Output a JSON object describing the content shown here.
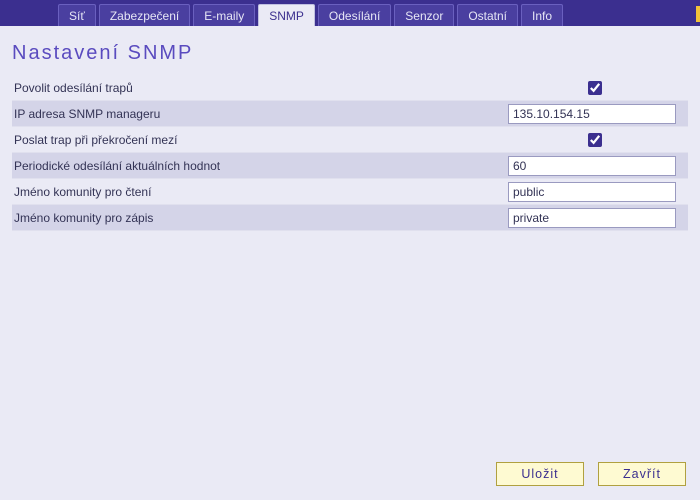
{
  "tabs": [
    {
      "id": "sit",
      "label": "Síť",
      "active": false
    },
    {
      "id": "zabezpeceni",
      "label": "Zabezpečení",
      "active": false
    },
    {
      "id": "emaily",
      "label": "E-maily",
      "active": false
    },
    {
      "id": "snmp",
      "label": "SNMP",
      "active": true
    },
    {
      "id": "odesilani",
      "label": "Odesílání",
      "active": false
    },
    {
      "id": "senzor",
      "label": "Senzor",
      "active": false
    },
    {
      "id": "ostatni",
      "label": "Ostatní",
      "active": false
    },
    {
      "id": "info",
      "label": "Info",
      "active": false
    }
  ],
  "page_title": "Nastavení SNMP",
  "rows": {
    "enable_traps": {
      "label": "Povolit odesílání trapů",
      "checked": true
    },
    "manager_ip": {
      "label": "IP adresa SNMP manageru",
      "value": "135.10.154.15"
    },
    "trap_on_limit": {
      "label": "Poslat trap při překročení mezí",
      "checked": true
    },
    "periodic": {
      "label": "Periodické odesílání aktuálních hodnot",
      "value": "60"
    },
    "comm_read": {
      "label": "Jméno komunity pro čtení",
      "value": "public"
    },
    "comm_write": {
      "label": "Jméno komunity pro zápis",
      "value": "private"
    }
  },
  "buttons": {
    "save": "Uložit",
    "close": "Zavřít"
  }
}
